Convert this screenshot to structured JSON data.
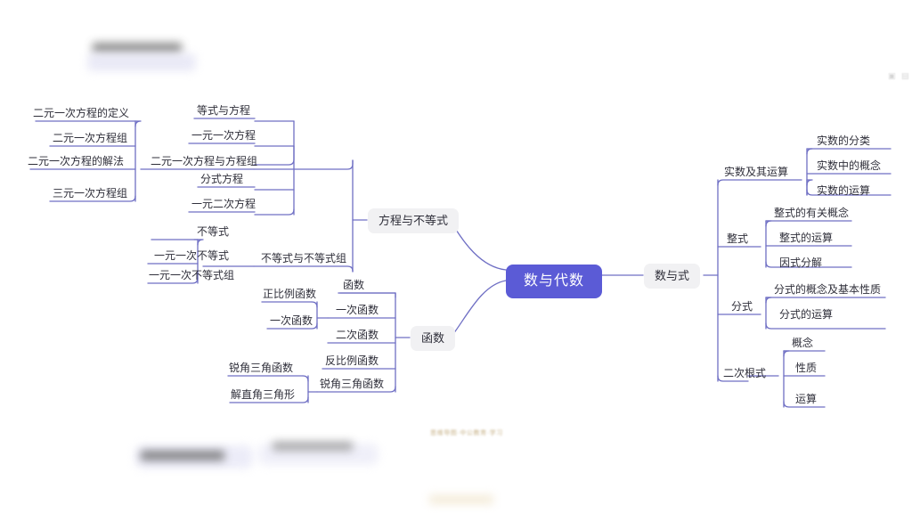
{
  "mindmap": {
    "root": {
      "label": "数与代数",
      "color": "#5b5bd6"
    },
    "branches": [
      {
        "label": "方程与不等式"
      },
      {
        "label": "函数"
      },
      {
        "label": "数与式"
      }
    ],
    "subnodes": [
      {
        "label": "二元一次方程与方程组"
      },
      {
        "label": "不等式与不等式组"
      },
      {
        "label": "函数"
      },
      {
        "label": "一次函数"
      },
      {
        "label": "二次函数"
      },
      {
        "label": "反比例函数"
      },
      {
        "label": "锐角三角函数"
      },
      {
        "label": "实数及其运算"
      },
      {
        "label": "整式"
      },
      {
        "label": "分式"
      },
      {
        "label": "二次根式"
      }
    ],
    "leaves": [
      {
        "label": "二元一次方程的定义"
      },
      {
        "label": "二元一次方程组"
      },
      {
        "label": "二元一次方程的解法"
      },
      {
        "label": "三元一次方程组"
      },
      {
        "label": "等式与方程"
      },
      {
        "label": "一元一次方程"
      },
      {
        "label": "分式方程"
      },
      {
        "label": "一元二次方程"
      },
      {
        "label": "不等式"
      },
      {
        "label": "一元一次不等式"
      },
      {
        "label": "一元一次不等式组"
      },
      {
        "label": "正比例函数"
      },
      {
        "label": "一次函数"
      },
      {
        "label": "锐角三角函数"
      },
      {
        "label": "解直角三角形"
      },
      {
        "label": "实数的分类"
      },
      {
        "label": "实数中的概念"
      },
      {
        "label": "实数的运算"
      },
      {
        "label": "整式的有关概念"
      },
      {
        "label": "整式的运算"
      },
      {
        "label": "因式分解"
      },
      {
        "label": "分式的概念及基本性质"
      },
      {
        "label": "分式的运算"
      },
      {
        "label": "概念"
      },
      {
        "label": "性质"
      },
      {
        "label": "运算"
      }
    ],
    "watermark": {
      "text": "思维导图·中公教育·学习"
    },
    "line_color": "#6f6fc4"
  }
}
